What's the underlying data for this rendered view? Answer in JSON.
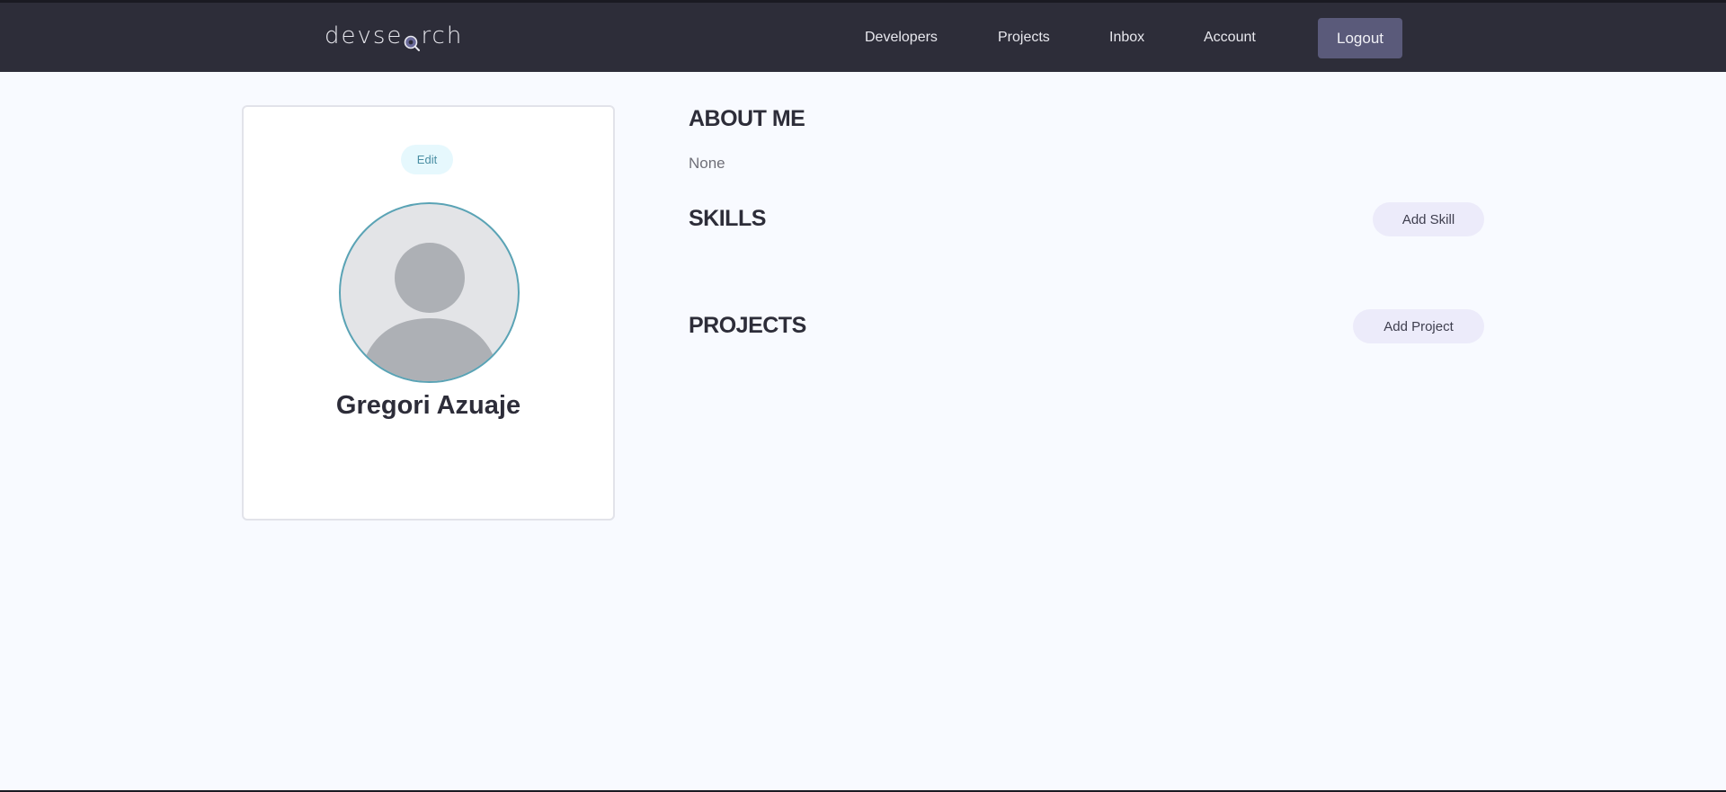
{
  "header": {
    "logo_left": "devse",
    "logo_right": "rch",
    "nav": [
      "Developers",
      "Projects",
      "Inbox",
      "Account"
    ],
    "logout_label": "Logout"
  },
  "profile": {
    "edit_label": "Edit",
    "name": "Gregori Azuaje",
    "avatar": "default-user-avatar"
  },
  "about": {
    "heading": "ABOUT ME",
    "text": "None"
  },
  "skills": {
    "heading": "SKILLS",
    "add_label": "Add Skill"
  },
  "projects": {
    "heading": "PROJECTS",
    "add_label": "Add Project"
  },
  "colors": {
    "header_bg": "#2d2d39",
    "page_bg": "#f8faff",
    "logout_bg": "#5a5a7a",
    "edit_bg": "#e6f8fd",
    "pill_bg": "#ecebfa",
    "avatar_border": "#5aa3b5"
  }
}
